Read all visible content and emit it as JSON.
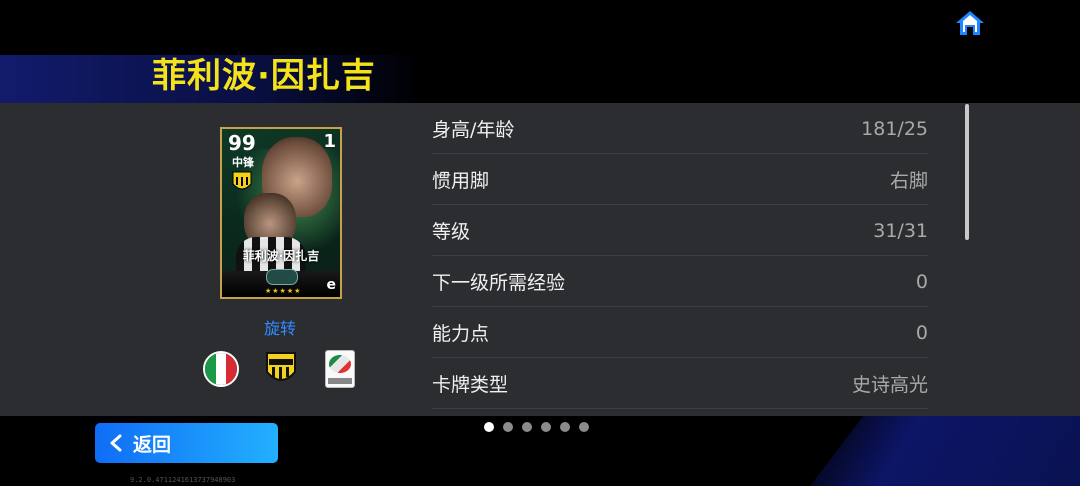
{
  "header": {
    "player_name": "菲利波·因扎吉"
  },
  "card": {
    "rating": "99",
    "position": "中锋",
    "number": "1",
    "name": "菲利波·因扎吉",
    "brand": "e",
    "stars": "★★★★★"
  },
  "rotate_label": "旋转",
  "badges": {
    "nationality": "italy-flag-icon",
    "club": "club-crest-icon",
    "league": "league-logo-icon"
  },
  "stats": [
    {
      "label": "身高/年龄",
      "value": "181/25"
    },
    {
      "label": "惯用脚",
      "value": "右脚"
    },
    {
      "label": "等级",
      "value": "31/31"
    },
    {
      "label": "下一级所需经验",
      "value": "0"
    },
    {
      "label": "能力点",
      "value": "0"
    },
    {
      "label": "卡牌类型",
      "value": "史诗高光"
    }
  ],
  "pagination": {
    "total": 6,
    "active": 1
  },
  "back_label": "返回",
  "version": "9.2.0.4711241613737948903",
  "colors": {
    "name_yellow": "#f5e31a",
    "accent_blue": "#2f8bff",
    "panel": "#2c2d30"
  }
}
